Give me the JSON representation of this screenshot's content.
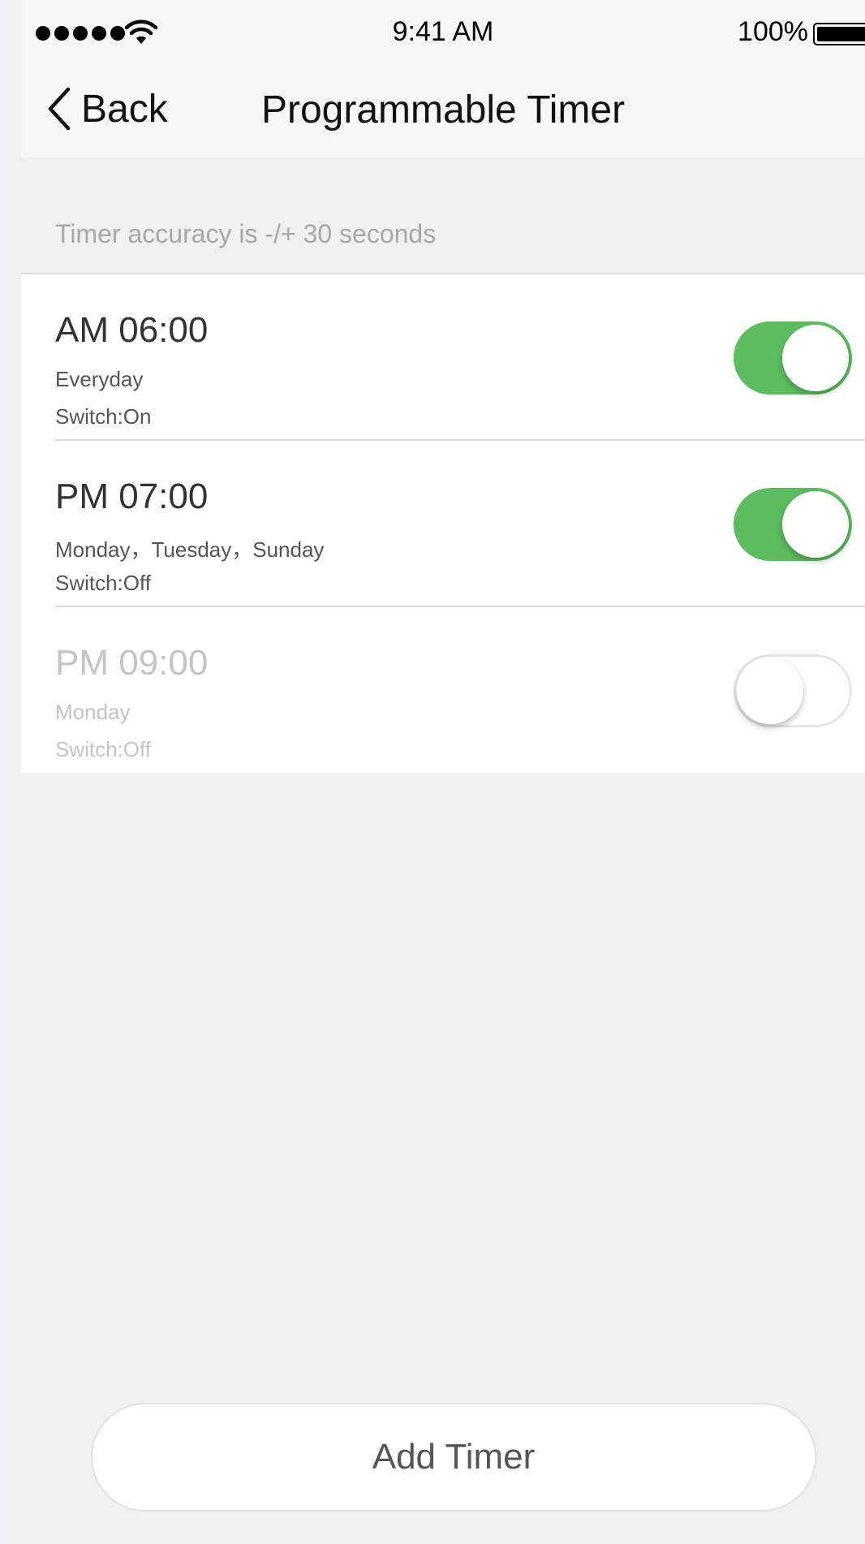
{
  "status_bar": {
    "time": "9:41 AM",
    "battery_percent": "100%",
    "signal_dots": 5,
    "icons": [
      "signal-icon",
      "wifi-icon",
      "battery-icon"
    ]
  },
  "nav": {
    "back_label": "Back",
    "title": "Programmable Timer",
    "back_icon": "chevron-left-icon"
  },
  "note": "Timer accuracy is -/+ 30 seconds",
  "timers": [
    {
      "time": "AM 06:00",
      "days": "Everyday",
      "switch": "Switch:On",
      "enabled": true
    },
    {
      "time": "PM 07:00",
      "days": "Monday，Tuesday，Sunday",
      "switch": "Switch:Off",
      "enabled": true
    },
    {
      "time": "PM 09:00",
      "days": "Monday",
      "switch": "Switch:Off",
      "enabled": false
    }
  ],
  "add_button_label": "Add Timer",
  "colors": {
    "toggle_on": "#5cbd60",
    "background": "#f0f0f0"
  }
}
